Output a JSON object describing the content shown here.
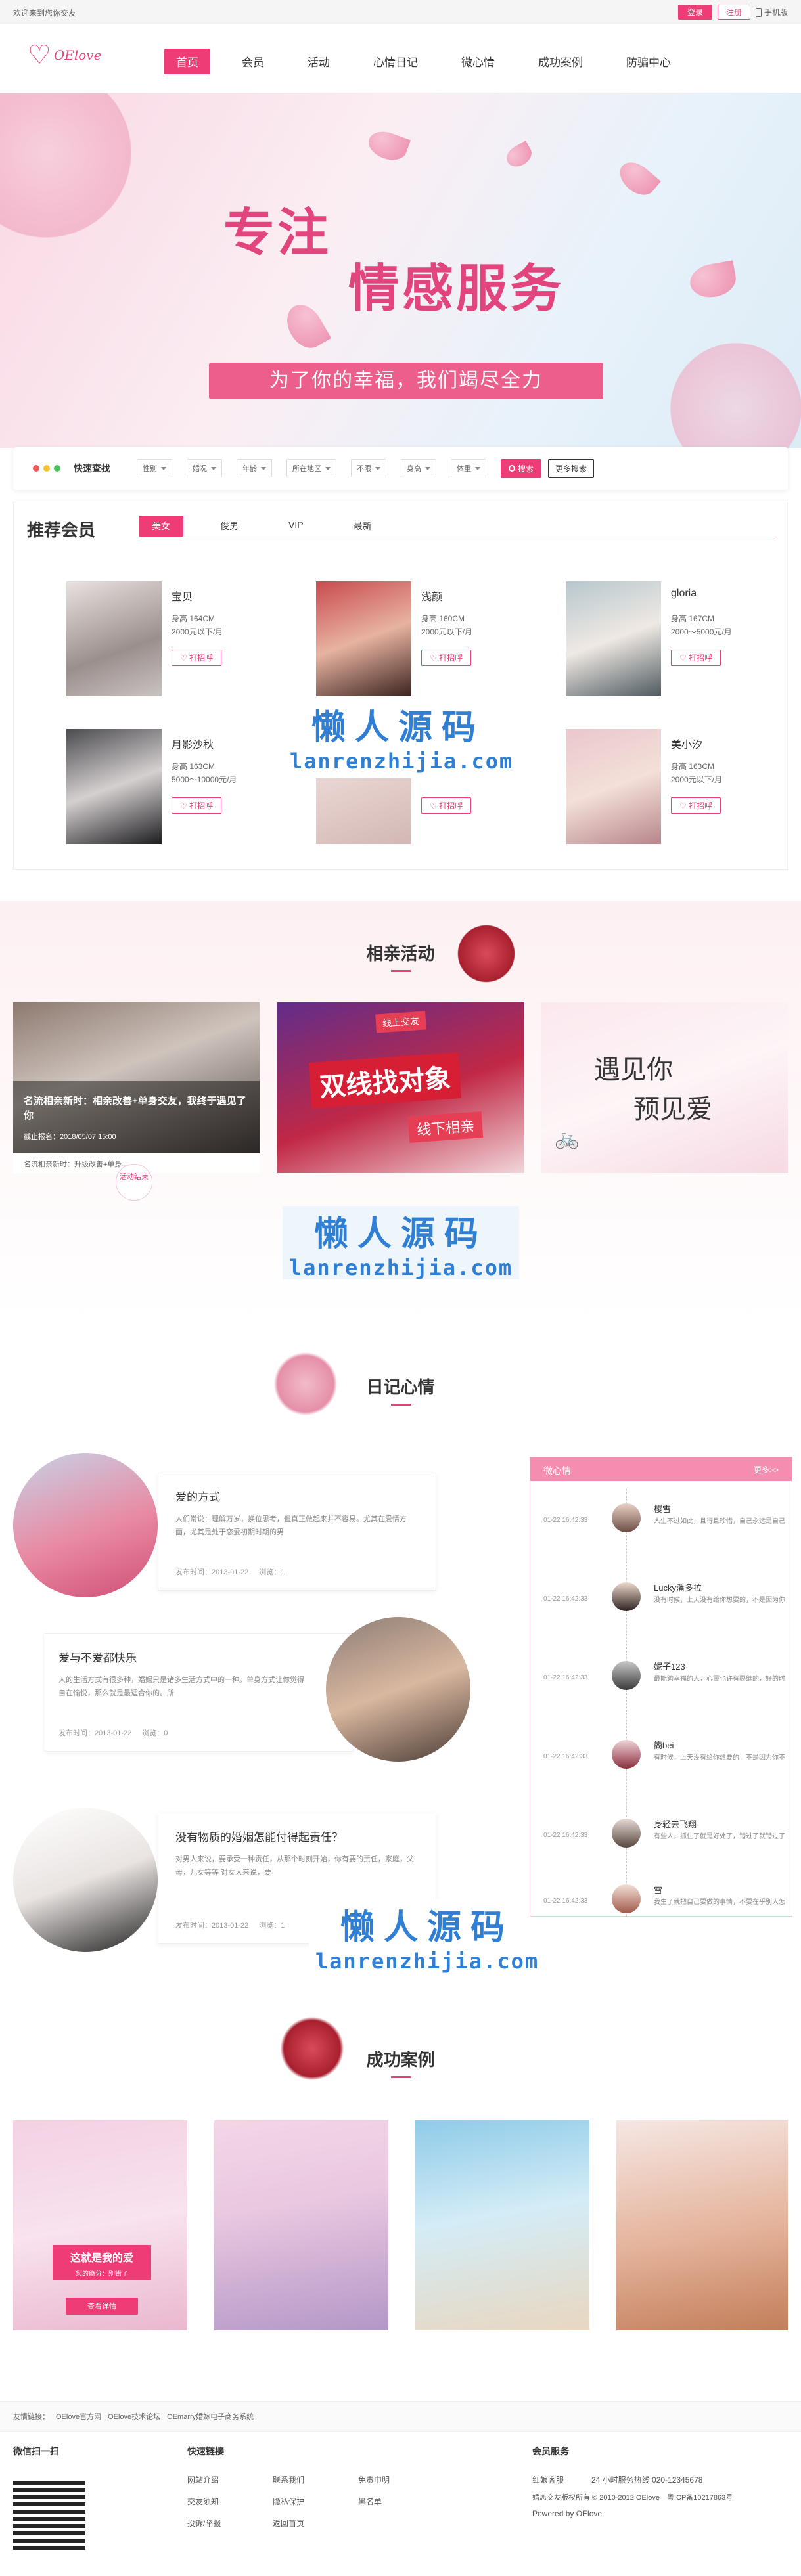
{
  "topbar": {
    "welcome": "欢迎来到您你交友",
    "login": "登录",
    "register": "注册",
    "mobile": "手机版"
  },
  "nav": {
    "logo_text": "OElove",
    "items": [
      "首页",
      "会员",
      "活动",
      "心情日记",
      "微心情",
      "成功案例",
      "防骗中心"
    ]
  },
  "banner": {
    "line1": "专注",
    "line2": "情感服务",
    "tagline": "为了你的幸福，我们竭尽全力"
  },
  "search": {
    "title": "快速查找",
    "filters": [
      "性别",
      "婚况",
      "年龄",
      "所在地区",
      "不限",
      "身高",
      "体重"
    ],
    "search_btn": "搜索",
    "more_btn": "更多搜索"
  },
  "recommend": {
    "title": "推荐会员",
    "tabs": [
      "美女",
      "俊男",
      "VIP",
      "最新"
    ],
    "members": [
      {
        "name": "宝贝",
        "height": "身高 164CM",
        "income": "2000元以下/月",
        "greet": "打招呼"
      },
      {
        "name": "浅颜",
        "height": "身高 160CM",
        "income": "2000元以下/月",
        "greet": "打招呼"
      },
      {
        "name": "gloria",
        "height": "身高 167CM",
        "income": "2000～5000元/月",
        "greet": "打招呼"
      },
      {
        "name": "月影沙秋",
        "height": "身高 163CM",
        "income": "5000～10000元/月",
        "greet": "打招呼"
      },
      {
        "name": "",
        "height": "",
        "income": "",
        "greet": "打招呼"
      },
      {
        "name": "美小汐",
        "height": "身高 163CM",
        "income": "2000元以下/月",
        "greet": "打招呼"
      }
    ]
  },
  "watermark": {
    "cn": "懒人源码",
    "en": "lanrenzhijia.com"
  },
  "activity": {
    "title": "相亲活动",
    "items": [
      {
        "caption": "名流相亲新时：相亲改善+单身交友，我终于遇见了你",
        "date": "截止报名：2018/05/07 15:00",
        "footer": "名流相亲新时：升级改善+单身...",
        "badge": "活动结束"
      },
      {
        "big1": "双线找对象",
        "tag1": "线上交友",
        "tag2": "线下相亲"
      },
      {
        "big1": "遇见你",
        "big2": "预见爱"
      }
    ]
  },
  "diary": {
    "title": "日记心情",
    "items": [
      {
        "title": "爱的方式",
        "text": "人们常说：理解万岁，换位思考，但真正做起来并不容易。尤其在爱情方面，尤其是处于恋爱初期时期的男",
        "date": "发布时间：2013-01-22",
        "views": "浏览：1"
      },
      {
        "title": "爱与不爱都快乐",
        "text": "人的生活方式有很多种，婚姻只是诸多生活方式中的一种。单身方式让你觉得自在愉悦，那么就是最适合你的。所",
        "date": "发布时间：2013-01-22",
        "views": "浏览：0"
      },
      {
        "title": "没有物质的婚姻怎能付得起责任？",
        "text": "对男人来说，要承受一种责任，从那个时刻开始，你有要的责任，家庭，父母，儿女等等 对女人来说，要",
        "date": "发布时间：2013-01-22",
        "views": "浏览：1"
      }
    ]
  },
  "mood": {
    "title": "微心情",
    "more": "更多>>",
    "items": [
      {
        "time": "01-22 16:42:33",
        "name": "樱雪",
        "text": "人生不过如此，且行且珍惜，自己永远是自己的主角，不要在别人的戏"
      },
      {
        "time": "01-22 16:42:33",
        "name": "Lucky潘多拉",
        "text": "没有时候，上天没有给你想要的，不是因为你不配，而是你值得拥有更好"
      },
      {
        "time": "01-22 16:42:33",
        "name": "妮子123",
        "text": "最能夠幸福的人，心靈也许有裂缝的，好的时光会治愈"
      },
      {
        "time": "01-22 16:42:33",
        "name": "簡bei",
        "text": "有时候，上天没有给你想要的，不是因为你不配，而是你值得拥有更好"
      },
      {
        "time": "01-22 16:42:33",
        "name": "身轻去飞翔",
        "text": "有些人，抓住了就是好处了，错过了就错过了，只能说缘薄无缘。人生"
      },
      {
        "time": "01-22 16:42:33",
        "name": "雪",
        "text": "我生了就把自己要做的事情，不要在乎别人怎么说，怎么评价你"
      }
    ]
  },
  "cases": {
    "title": "成功案例",
    "card1_title": "这就是我的爱",
    "card1_sub": "您的缘分：别错了",
    "card1_btn": "查看详情"
  },
  "footer": {
    "links_label": "友情链接：",
    "links": [
      "OElove官方网",
      "OElove技术论坛",
      "OEmarry婚嫁电子商务系统"
    ],
    "wechat": "微信扫一扫",
    "quick": "快速链接",
    "quick_links": [
      "网站介绍",
      "联系我们",
      "免责申明",
      "交友须知",
      "隐私保护",
      "黑名单",
      "投诉/举报",
      "返回首页"
    ],
    "service": "会员服务",
    "s1": "红娘客服",
    "s2": "24 小时服务热线 020-12345678",
    "s3": "婚恋交友版权所有 © 2010-2012 OElove　粤ICP备10217863号",
    "s4": "Powered by OElove"
  },
  "colors": {
    "accent": "#ee3d76",
    "mood_header": "#f58db1",
    "watermark": "#2f7fd4"
  }
}
